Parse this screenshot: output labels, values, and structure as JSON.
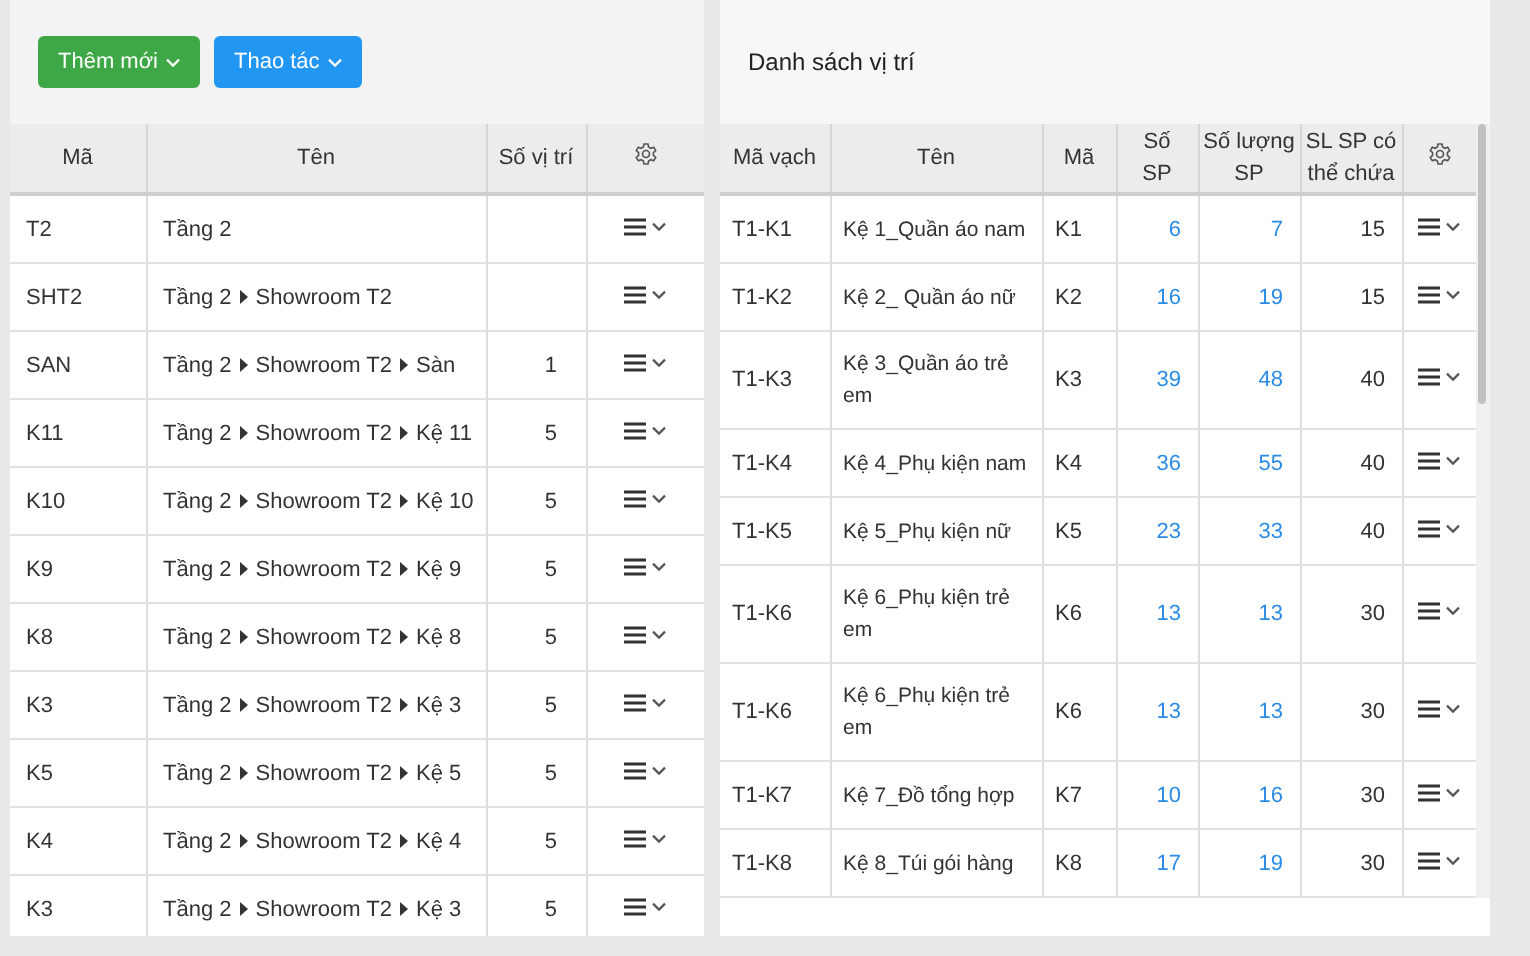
{
  "toolbar": {
    "buttons": [
      {
        "label": "Thêm mới",
        "kind": "add"
      },
      {
        "label": "Thao tác",
        "kind": "actions"
      }
    ]
  },
  "locations_table": {
    "columns": [
      "Mã",
      "Tên",
      "Số vị trí"
    ],
    "rows": [
      {
        "code": "T2",
        "path": [
          "Tầng 2"
        ]
      },
      {
        "code": "SHT2",
        "path": [
          "Tầng 2",
          "Showroom T2"
        ]
      },
      {
        "code": "SAN",
        "path": [
          "Tầng 2",
          "Showroom T2",
          "Sàn"
        ],
        "count": "1"
      },
      {
        "code": "K11",
        "path": [
          "Tầng 2",
          "Showroom T2",
          "Kệ 11"
        ],
        "count": "5"
      },
      {
        "code": "K10",
        "path": [
          "Tầng 2",
          "Showroom T2",
          "Kệ 10"
        ],
        "count": "5"
      },
      {
        "code": "K9",
        "path": [
          "Tầng 2",
          "Showroom T2",
          "Kệ 9"
        ],
        "count": "5"
      },
      {
        "code": "K8",
        "path": [
          "Tầng 2",
          "Showroom T2",
          "Kệ 8"
        ],
        "count": "5"
      },
      {
        "code": "K3",
        "path": [
          "Tầng 2",
          "Showroom T2",
          "Kệ 3"
        ],
        "count": "5"
      },
      {
        "code": "K5",
        "path": [
          "Tầng 2",
          "Showroom T2",
          "Kệ 5"
        ],
        "count": "5"
      },
      {
        "code": "K4",
        "path": [
          "Tầng 2",
          "Showroom T2",
          "Kệ 4"
        ],
        "count": "5"
      },
      {
        "code": "K3",
        "path": [
          "Tầng 2",
          "Showroom T2",
          "Kệ 3"
        ],
        "count": "5"
      }
    ]
  },
  "position_list": {
    "title": "Danh sách vị trí",
    "columns": [
      "Mã vạch",
      "Tên",
      "Mã",
      "Số SP",
      "Số lượng SP",
      "SL SP có thể chứa"
    ],
    "rows": [
      {
        "barcode": "T1-K1",
        "name": "Kệ 1_Quần áo nam",
        "code": "K1",
        "products": "6",
        "quantity": "7",
        "capacity": "15"
      },
      {
        "barcode": "T1-K2",
        "name": "Kệ 2_ Quần áo nữ",
        "code": "K2",
        "products": "16",
        "quantity": "19",
        "capacity": "15"
      },
      {
        "barcode": "T1-K3",
        "name": "Kệ 3_Quần áo trẻ em",
        "code": "K3",
        "products": "39",
        "quantity": "48",
        "capacity": "40"
      },
      {
        "barcode": "T1-K4",
        "name": "Kệ 4_Phụ kiện nam",
        "code": "K4",
        "products": "36",
        "quantity": "55",
        "capacity": "40"
      },
      {
        "barcode": "T1-K5",
        "name": "Kệ 5_Phụ kiện nữ",
        "code": "K5",
        "products": "23",
        "quantity": "33",
        "capacity": "40"
      },
      {
        "barcode": "T1-K6",
        "name": "Kệ 6_Phụ kiện trẻ em",
        "code": "K6",
        "products": "13",
        "quantity": "13",
        "capacity": "30"
      },
      {
        "barcode": "T1-K6",
        "name": "Kệ 6_Phụ kiện trẻ em",
        "code": "K6",
        "products": "13",
        "quantity": "13",
        "capacity": "30"
      },
      {
        "barcode": "T1-K7",
        "name": "Kệ 7_Đồ tổng hợp",
        "code": "K7",
        "products": "10",
        "quantity": "16",
        "capacity": "30"
      },
      {
        "barcode": "T1-K8",
        "name": "Kệ 8_Túi gói hàng",
        "code": "K8",
        "products": "17",
        "quantity": "19",
        "capacity": "30"
      }
    ]
  }
}
